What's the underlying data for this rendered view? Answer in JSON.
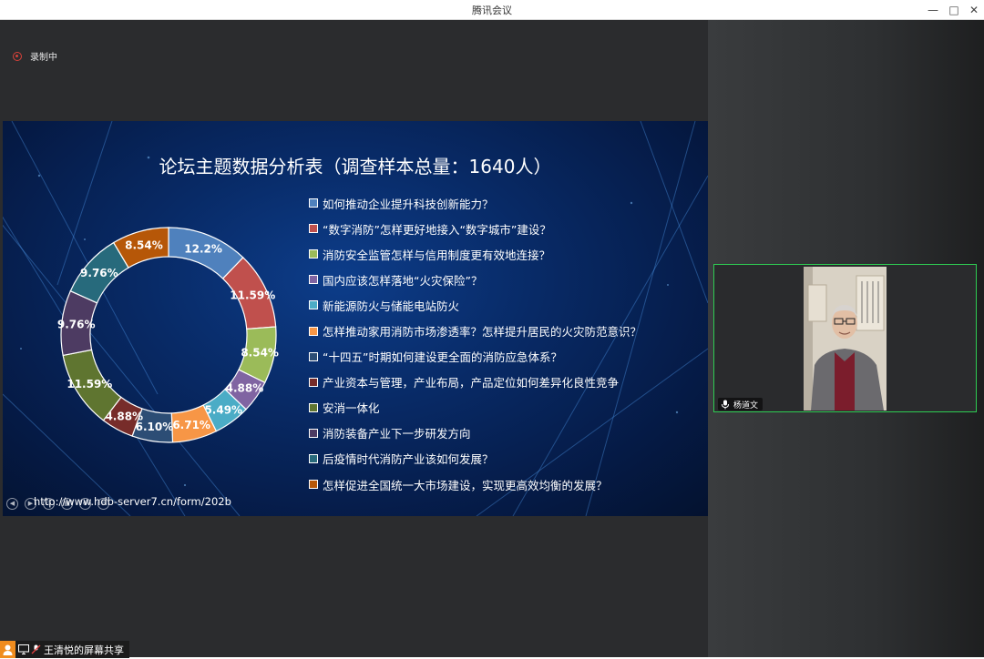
{
  "window": {
    "title": "腾讯会议",
    "minimize": "—",
    "maximize": "□",
    "close": "✕"
  },
  "recording": {
    "label": "录制中"
  },
  "slide": {
    "title": "论坛主题数据分析表（调查样本总量：1640人）",
    "url": "http://www.hdb-server7.cn/form/202b",
    "nav_icons": [
      "◀",
      "▶",
      "⊙",
      "▦",
      "⊕",
      "⊖"
    ]
  },
  "chart_data": {
    "type": "pie",
    "title": "论坛主题数据分析表（调查样本总量：1640人）",
    "categories": [
      "如何推动企业提升科技创新能力？",
      "“数字消防”怎样更好地接入“数字城市”建设？",
      "消防安全监管怎样与信用制度更有效地连接？",
      "国内应该怎样落地“火灾保险”？",
      "新能源防火与储能电站防火",
      "怎样推动家用消防市场渗透率？怎样提升居民的火灾防范意识？",
      "“十四五”时期如何建设更全面的消防应急体系？",
      "产业资本与管理，产业布局，产品定位如何差异化良性竞争",
      "安消一体化",
      "消防装备产业下一步研发方向",
      "后疫情时代消防产业该如何发展？",
      "怎样促进全国统一大市场建设，实现更高效均衡的发展？"
    ],
    "values": [
      12.2,
      11.59,
      8.54,
      4.88,
      5.49,
      6.71,
      6.1,
      4.88,
      11.59,
      9.76,
      9.76,
      8.54
    ],
    "labels": [
      "12.2%",
      "11.59%",
      "8.54%",
      "4.88%",
      "5.49%",
      "6.71%",
      "6.10%",
      "4.88%",
      "11.59%",
      "9.76%",
      "9.76%",
      "8.54%"
    ],
    "colors": [
      "#4f81bd",
      "#c0504d",
      "#9bbb59",
      "#8064a2",
      "#4bacc6",
      "#f79646",
      "#2c4d75",
      "#772c2a",
      "#5f7530",
      "#4d3b62",
      "#276a7c",
      "#b65708"
    ],
    "style": "donut",
    "legend_position": "right"
  },
  "participant": {
    "name": "杨道文",
    "mic_icon": "microphone-icon"
  },
  "share_status": {
    "label": "王清悦的屏幕共享"
  }
}
